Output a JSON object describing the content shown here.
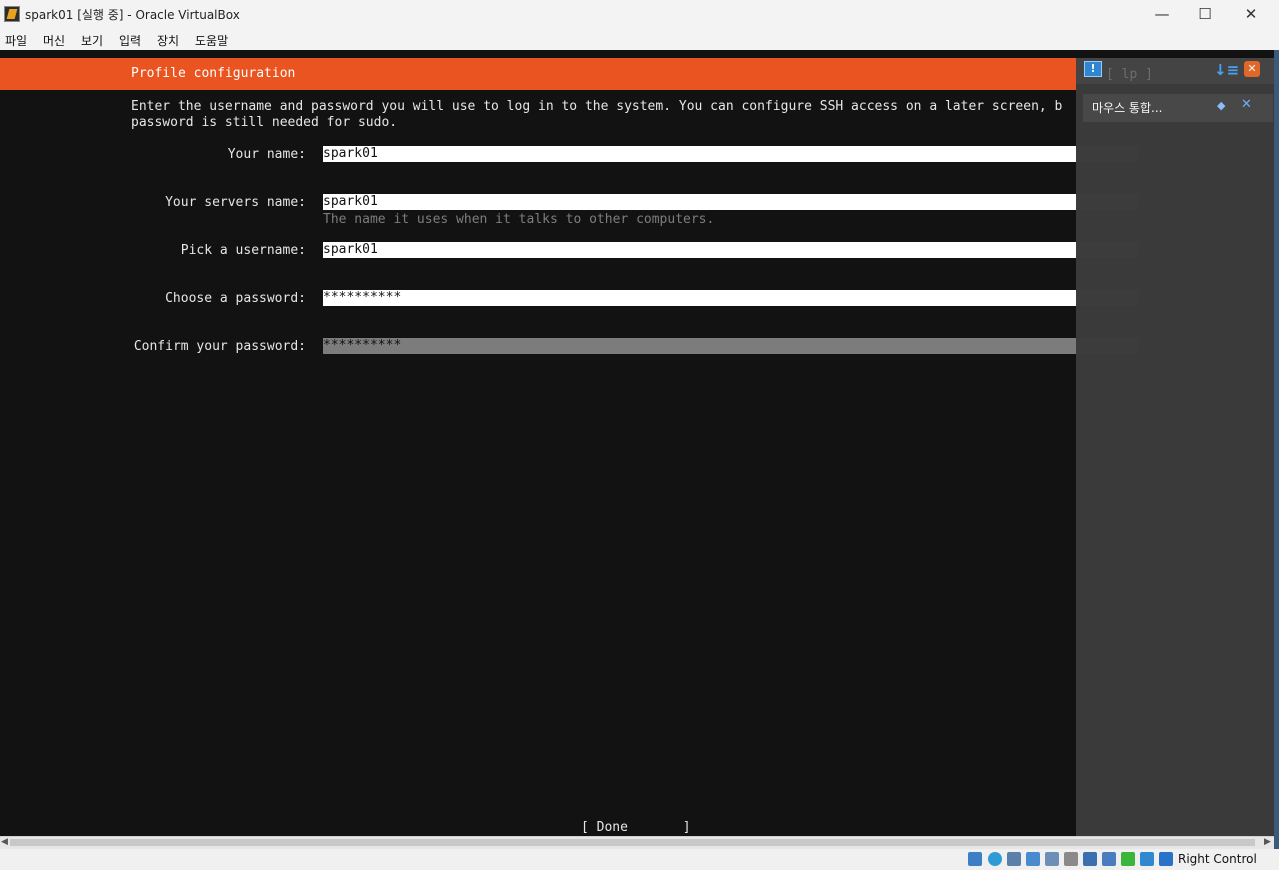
{
  "window": {
    "title": "spark01 [실행 중] - Oracle VirtualBox",
    "minimize": "—",
    "maximize": "☐",
    "close": "✕"
  },
  "menu": [
    "파일",
    "머신",
    "보기",
    "입력",
    "장치",
    "도움말"
  ],
  "installer": {
    "header": "Profile configuration",
    "intro": "Enter the username and password you will use to log in to the system. You can configure SSH access on a later screen, b\npassword is still needed for sudo.",
    "fields": [
      {
        "label": "Your name:",
        "value": "spark01"
      },
      {
        "label": "Your servers name:",
        "value": "spark01"
      },
      {
        "label": "Pick a username:",
        "value": "spark01"
      },
      {
        "label": "Choose a password:",
        "value": "**********"
      },
      {
        "label": "Confirm your password:",
        "value": "**********"
      }
    ],
    "servers_name_hint": "The name it uses when it talks to other computers.",
    "done_button": "[ Done       ]",
    "header_ghost": "[ lp ]"
  },
  "notification": {
    "message": "마우스 통합...",
    "message_icon": "!",
    "sort_icon": "↓≡",
    "hide_icon": "✕"
  },
  "statusbar": {
    "host_key": "Right Control",
    "icons": [
      "hard-disk-icon",
      "optical-drive-icon",
      "audio-icon",
      "network-icon",
      "usb-icon",
      "shared-folder-icon",
      "display-icon",
      "recording-icon",
      "cpu-icon",
      "mouse-integration-icon",
      "keyboard-capture-icon"
    ]
  },
  "colors": {
    "ubuntu_orange": "#e95420",
    "terminal_bg": "#121212",
    "overlay_bg": "#3c3c3c"
  }
}
